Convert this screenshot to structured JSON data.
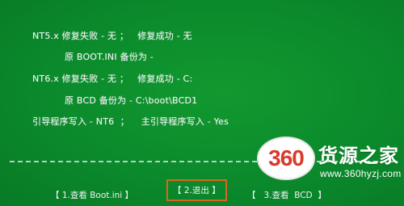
{
  "console": {
    "lines": [
      "NT5.x 修复失败 - 无 ；   修复成功 - 无",
      "原 BOOT.INI 备份为 -",
      "NT6.x 修复失败 - 无 ；   修复成功 - C:",
      "原 BCD 备份为 - C:\\boot\\BCD1",
      "引导程序写入 - NT6  ；    主引导程序写入 - Yes"
    ]
  },
  "menu": {
    "items": [
      {
        "label": "【 1.查看 Boot.ini 】"
      },
      {
        "label": "【 2.退出 】"
      },
      {
        "label": "【   3.查看  BCD  】"
      }
    ]
  },
  "colors": {
    "background": "#0a8a2c",
    "text": "#f2f2f2",
    "highlight_border": "#d9651f",
    "logo_red": "#d93a2b"
  },
  "watermark": {
    "badge": "360",
    "title": "货源之家",
    "url": "www.360hyzj.com"
  }
}
